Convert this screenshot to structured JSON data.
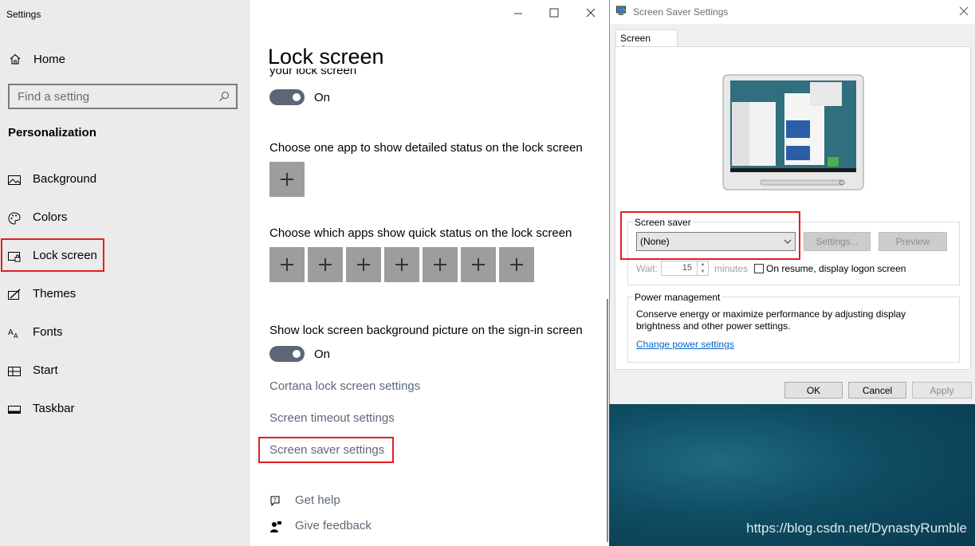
{
  "settings": {
    "app_title": "Settings",
    "home": "Home",
    "search_placeholder": "Find a setting",
    "section": "Personalization",
    "nav": [
      {
        "label": "Background",
        "icon": "picture-icon"
      },
      {
        "label": "Colors",
        "icon": "palette-icon"
      },
      {
        "label": "Lock screen",
        "icon": "lock-screen-icon"
      },
      {
        "label": "Themes",
        "icon": "themes-icon"
      },
      {
        "label": "Fonts",
        "icon": "fonts-icon"
      },
      {
        "label": "Start",
        "icon": "start-icon"
      },
      {
        "label": "Taskbar",
        "icon": "taskbar-icon"
      }
    ],
    "selected_nav": "Lock screen",
    "page_title": "Lock screen",
    "cut_text": "your lock screen",
    "toggle1_state": "On",
    "detailed_status_label": "Choose one app to show detailed status on the lock screen",
    "quick_status_label": "Choose which apps show quick status on the lock screen",
    "quick_status_slots": 7,
    "signin_bg_label": "Show lock screen background picture on the sign-in screen",
    "toggle2_state": "On",
    "links": [
      "Cortana lock screen settings",
      "Screen timeout settings",
      "Screen saver settings"
    ],
    "get_help": "Get help",
    "give_feedback": "Give feedback"
  },
  "dialog": {
    "title": "Screen Saver Settings",
    "tab": "Screen Saver",
    "screen_saver_group": "Screen saver",
    "selected": "(None)",
    "settings_btn": "Settings...",
    "preview_btn": "Preview",
    "wait_label": "Wait:",
    "wait_value": "15",
    "minutes_label": "minutes",
    "resume_label": "On resume, display logon screen",
    "resume_checked": false,
    "power_group": "Power management",
    "power_text": "Conserve energy or maximize performance by adjusting display brightness and other power settings.",
    "power_link": "Change power settings",
    "ok": "OK",
    "cancel": "Cancel",
    "apply": "Apply"
  },
  "watermark": "https://blog.csdn.net/DynastyRumble",
  "colors": {
    "highlight": "#e02020",
    "toggle_on": "#5d6676",
    "link": "#5c6877",
    "plus_tile": "#9d9d9d"
  }
}
